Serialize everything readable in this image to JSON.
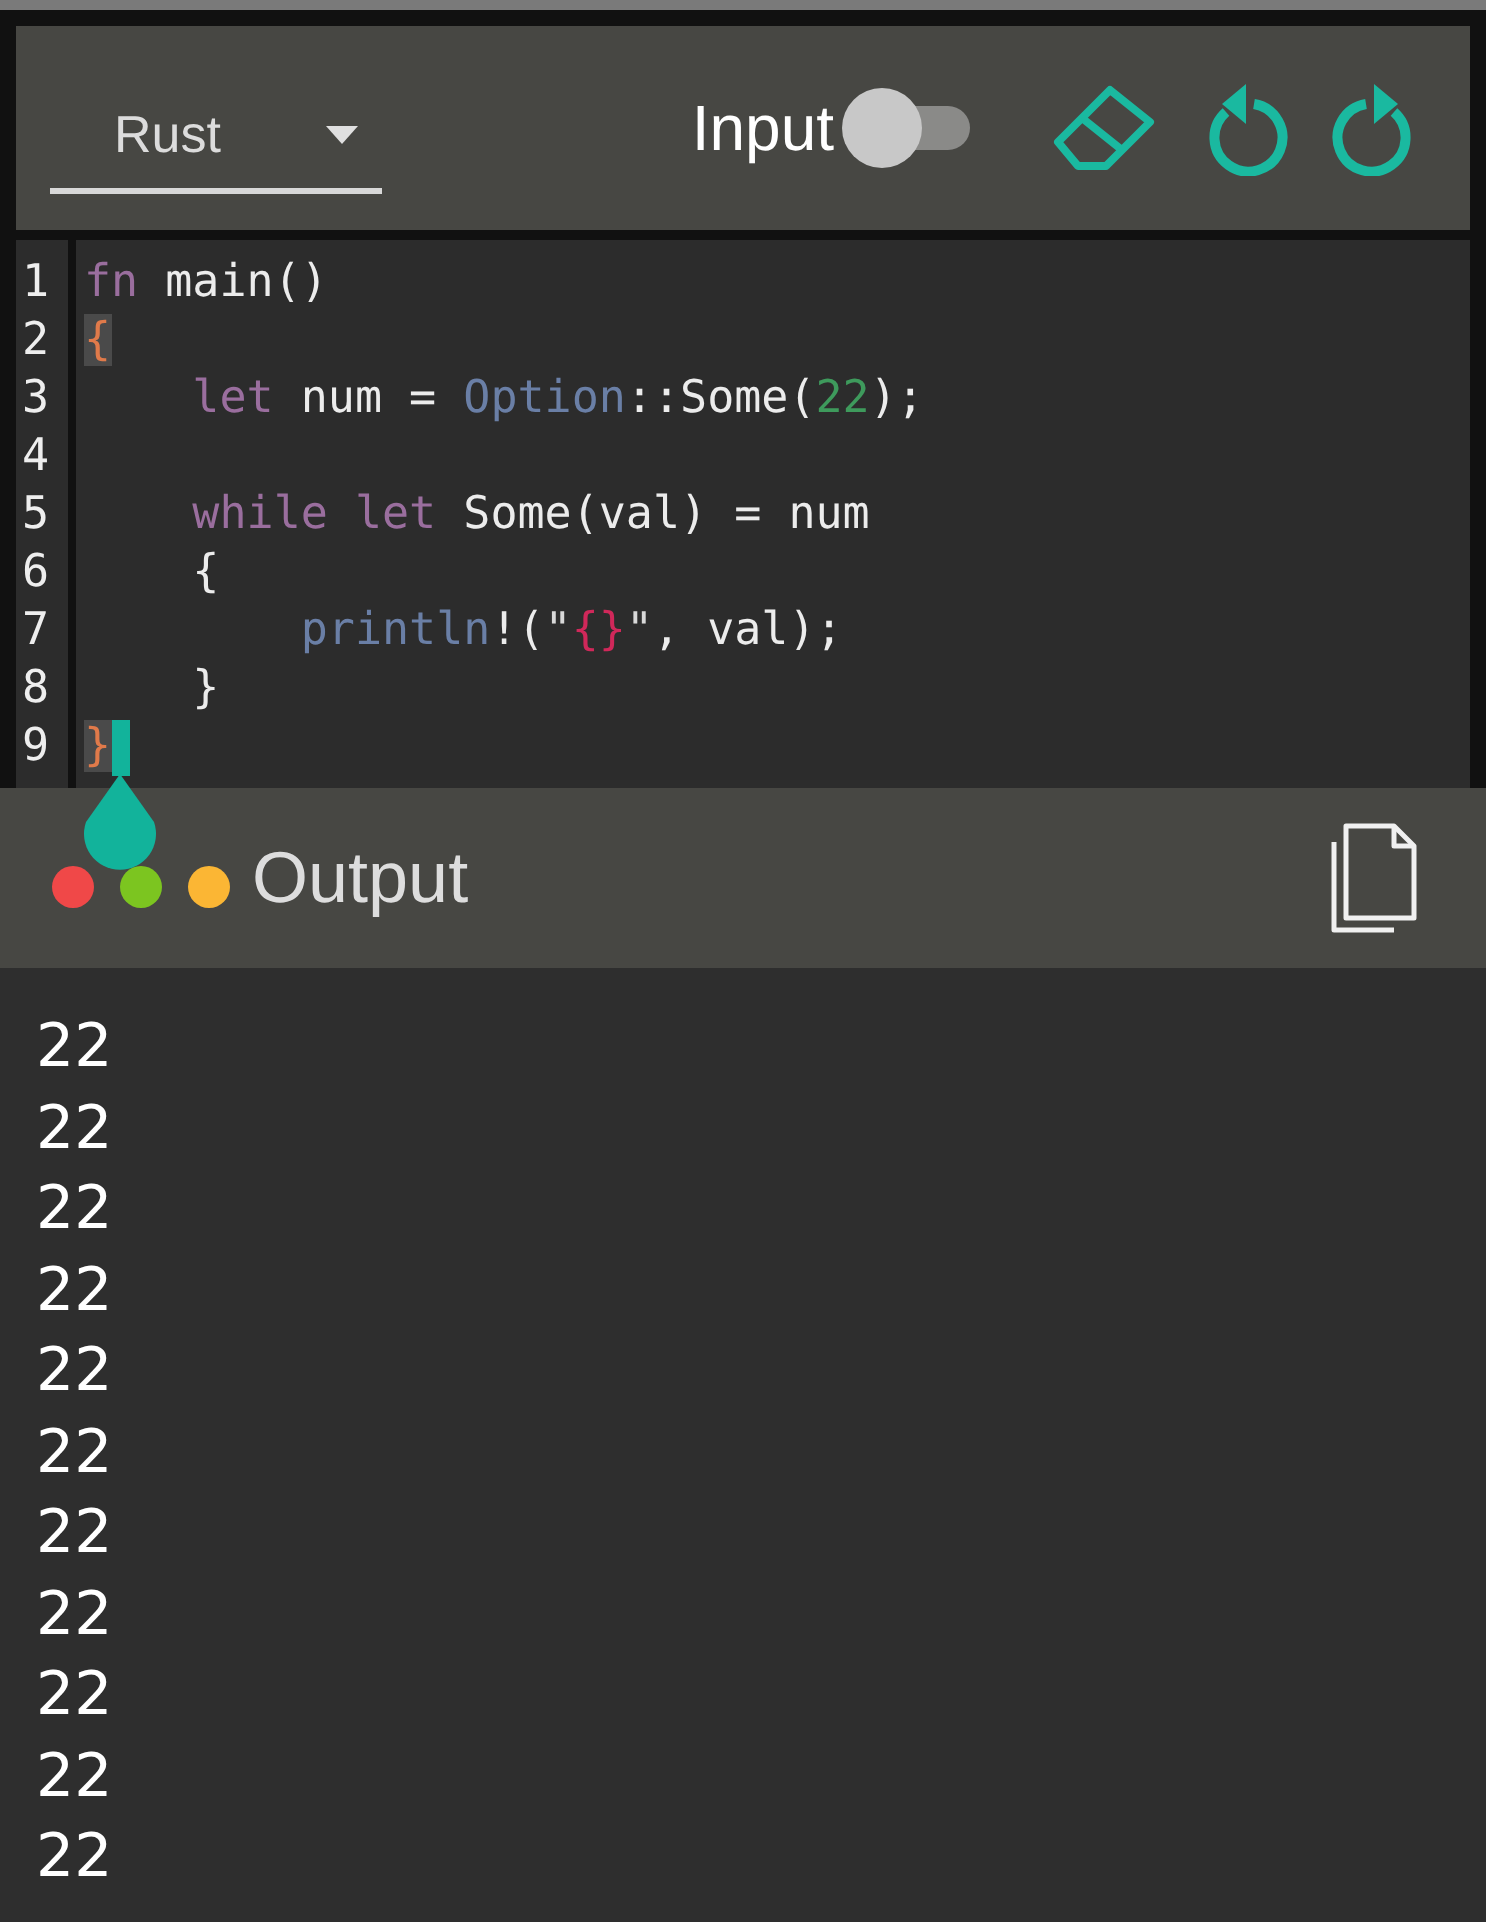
{
  "toolbar": {
    "language": {
      "value": "Rust"
    },
    "input_toggle": {
      "label": "Input",
      "on": false
    }
  },
  "editor": {
    "lines": [
      {
        "number": "1",
        "tokens": [
          {
            "kind": "keyword",
            "text": "fn"
          },
          {
            "kind": "plain",
            "text": " main()"
          }
        ]
      },
      {
        "number": "2",
        "tokens": [
          {
            "kind": "bracket",
            "text": "{"
          }
        ]
      },
      {
        "number": "3",
        "tokens": [
          {
            "kind": "keyword",
            "text": "    let"
          },
          {
            "kind": "plain",
            "text": " num = "
          },
          {
            "kind": "type",
            "text": "Option"
          },
          {
            "kind": "plain",
            "text": "::Some("
          },
          {
            "kind": "number",
            "text": "22"
          },
          {
            "kind": "plain",
            "text": ");"
          }
        ]
      },
      {
        "number": "4"
      },
      {
        "number": "5",
        "tokens": [
          {
            "kind": "keyword",
            "text": "    while let"
          },
          {
            "kind": "plain",
            "text": " Some(val) = num"
          }
        ]
      },
      {
        "number": "6",
        "tokens": [
          {
            "kind": "plain",
            "text": "    {"
          }
        ]
      },
      {
        "number": "7",
        "tokens": [
          {
            "kind": "type",
            "text": "        println"
          },
          {
            "kind": "plain",
            "text": "!("
          },
          {
            "kind": "string",
            "text": "\""
          },
          {
            "kind": "escape",
            "text": "{}"
          },
          {
            "kind": "string",
            "text": "\""
          },
          {
            "kind": "plain",
            "text": ", val);"
          }
        ]
      },
      {
        "number": "8",
        "tokens": [
          {
            "kind": "plain",
            "text": "    }"
          }
        ]
      },
      {
        "number": "9",
        "tokens": [
          {
            "kind": "bracket",
            "text": "}"
          }
        ],
        "cursor": true
      }
    ]
  },
  "output": {
    "title": "Output",
    "dots": [
      {
        "color": "#f04848"
      },
      {
        "color": "#7cc520"
      },
      {
        "color": "#fbb634"
      }
    ],
    "lines": [
      "22",
      "22",
      "22",
      "22",
      "22",
      "22",
      "22",
      "22",
      "22",
      "22",
      "22"
    ]
  }
}
